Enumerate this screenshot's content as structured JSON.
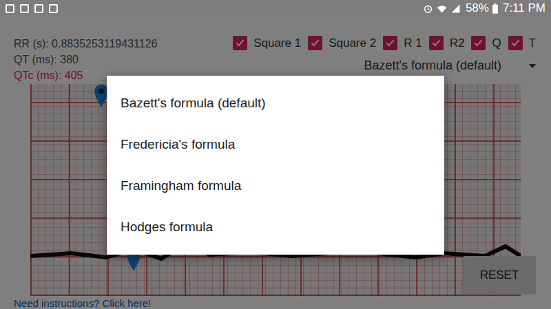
{
  "status_bar": {
    "battery": "58%",
    "time": "7:11 PM"
  },
  "readings": [
    {
      "label": "RR (s): 0.8835253119431126",
      "highlight": false
    },
    {
      "label": "QT (ms): 380",
      "highlight": false
    },
    {
      "label": "QTc (ms): 405",
      "highlight": true
    }
  ],
  "toggles": [
    {
      "label": "Square 1",
      "checked": true
    },
    {
      "label": "Square 2",
      "checked": true
    },
    {
      "label": "R 1",
      "checked": true
    },
    {
      "label": "R2",
      "checked": true
    },
    {
      "label": "Q",
      "checked": true
    },
    {
      "label": "T",
      "checked": true
    }
  ],
  "formula_select": {
    "value": "Bazett's formula (default)"
  },
  "help_link": "Need instructions? Click here!",
  "reset_button": "RESET",
  "dialog": {
    "options": [
      "Bazett's formula (default)",
      "Fredericia's formula",
      "Framingham formula",
      "Hodges formula"
    ]
  }
}
